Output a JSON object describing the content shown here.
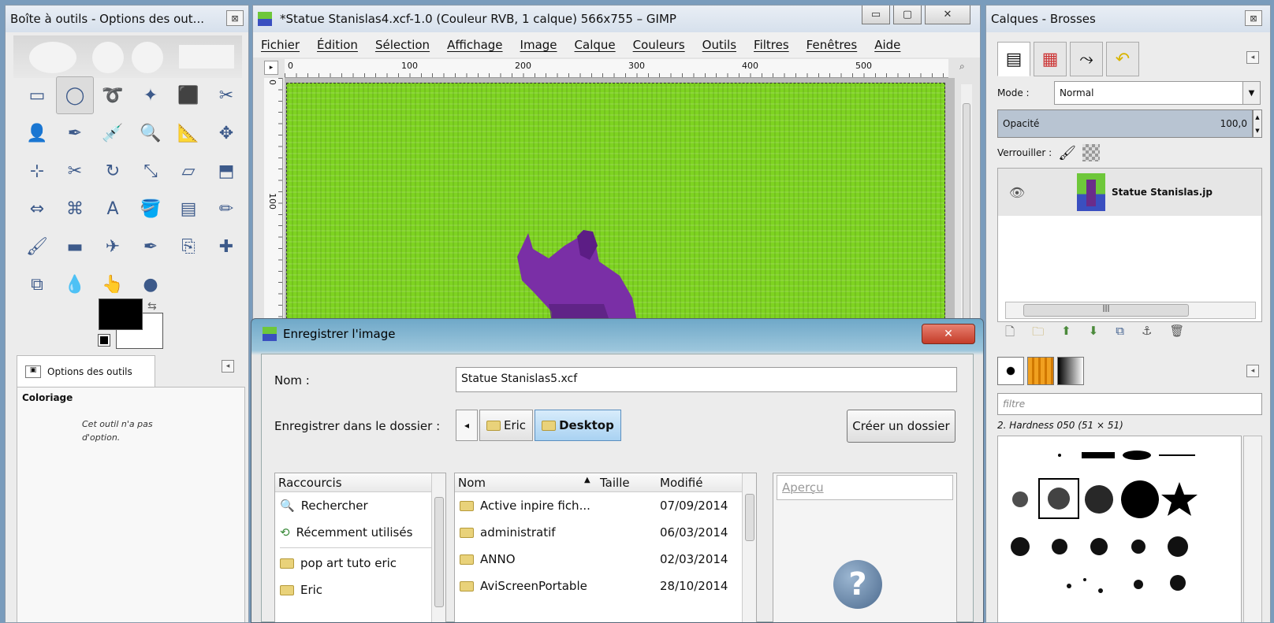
{
  "toolbox": {
    "title": "Boîte à outils - Options des out...",
    "tools": [
      "rect-select",
      "ellipse-select",
      "free-select",
      "fuzzy-select",
      "color-select",
      "scissors",
      "foreground-select",
      "paths",
      "color-picker",
      "zoom",
      "measure",
      "move",
      "align",
      "crop",
      "rotate",
      "scale",
      "shear",
      "perspective",
      "flip",
      "cage",
      "text",
      "bucket-fill",
      "blend",
      "pencil",
      "paintbrush",
      "eraser",
      "airbrush",
      "ink",
      "clone",
      "heal",
      "perspective-clone",
      "blur",
      "smudge",
      "dodge-burn"
    ],
    "tool_glyphs": [
      "▭",
      "◯",
      "➰",
      "✦",
      "⬛",
      "✂",
      "👤",
      "✒",
      "💉",
      "🔍",
      "📐",
      "✥",
      "⊹",
      "✂",
      "↻",
      "⤡",
      "▱",
      "⬒",
      "⇔",
      "⌘",
      "A",
      "🪣",
      "▤",
      "✏",
      "🖌",
      "▬",
      "✈",
      "✒",
      "⎘",
      "✚",
      "⧉",
      "💧",
      "👆",
      "●"
    ],
    "fg_color": "#000000",
    "bg_color": "#ffffff",
    "options_tab_label": "Options des outils",
    "options_title": "Coloriage",
    "options_note": "Cet outil n'a pas d'option."
  },
  "gimp": {
    "title": "*Statue Stanislas4.xcf-1.0 (Couleur RVB, 1 calque) 566x755 – GIMP",
    "menu": [
      "Fichier",
      "Édition",
      "Sélection",
      "Affichage",
      "Image",
      "Calque",
      "Couleurs",
      "Outils",
      "Filtres",
      "Fenêtres",
      "Aide"
    ],
    "ruler_h": [
      "0",
      "100",
      "200",
      "300",
      "400",
      "500"
    ],
    "ruler_v": [
      "0",
      "100"
    ],
    "canvas_color": "#7ed321"
  },
  "layers": {
    "title": "Calques - Brosses",
    "mode_label": "Mode :",
    "mode_value": "Normal",
    "opacity_label": "Opacité",
    "opacity_value": "100,0",
    "lock_label": "Verrouiller :",
    "layer_name": "Statue Stanislas.jp",
    "filter_placeholder": "filtre",
    "brush_name": "2. Hardness 050 (51 × 51)"
  },
  "dialog": {
    "title": "Enregistrer l'image",
    "close": "✕",
    "name_label": "Nom :",
    "name_value": "Statue Stanislas5.xcf",
    "save_in_label": "Enregistrer dans le dossier :",
    "path": [
      "Eric",
      "Desktop"
    ],
    "create_folder": "Créer un dossier",
    "places_header": "Raccourcis",
    "places": [
      "Rechercher",
      "Récemment utilisés",
      "pop art tuto eric",
      "Eric"
    ],
    "files_headers": {
      "name": "Nom",
      "size": "Taille",
      "modified": "Modifié"
    },
    "files": [
      {
        "name": "Active inpire fich...",
        "size": "",
        "modified": "07/09/2014"
      },
      {
        "name": "administratif",
        "size": "",
        "modified": "06/03/2014"
      },
      {
        "name": "ANNO",
        "size": "",
        "modified": "02/03/2014"
      },
      {
        "name": "AviScreenPortable",
        "size": "",
        "modified": "28/10/2014"
      }
    ],
    "preview_label": "Aperçu"
  }
}
